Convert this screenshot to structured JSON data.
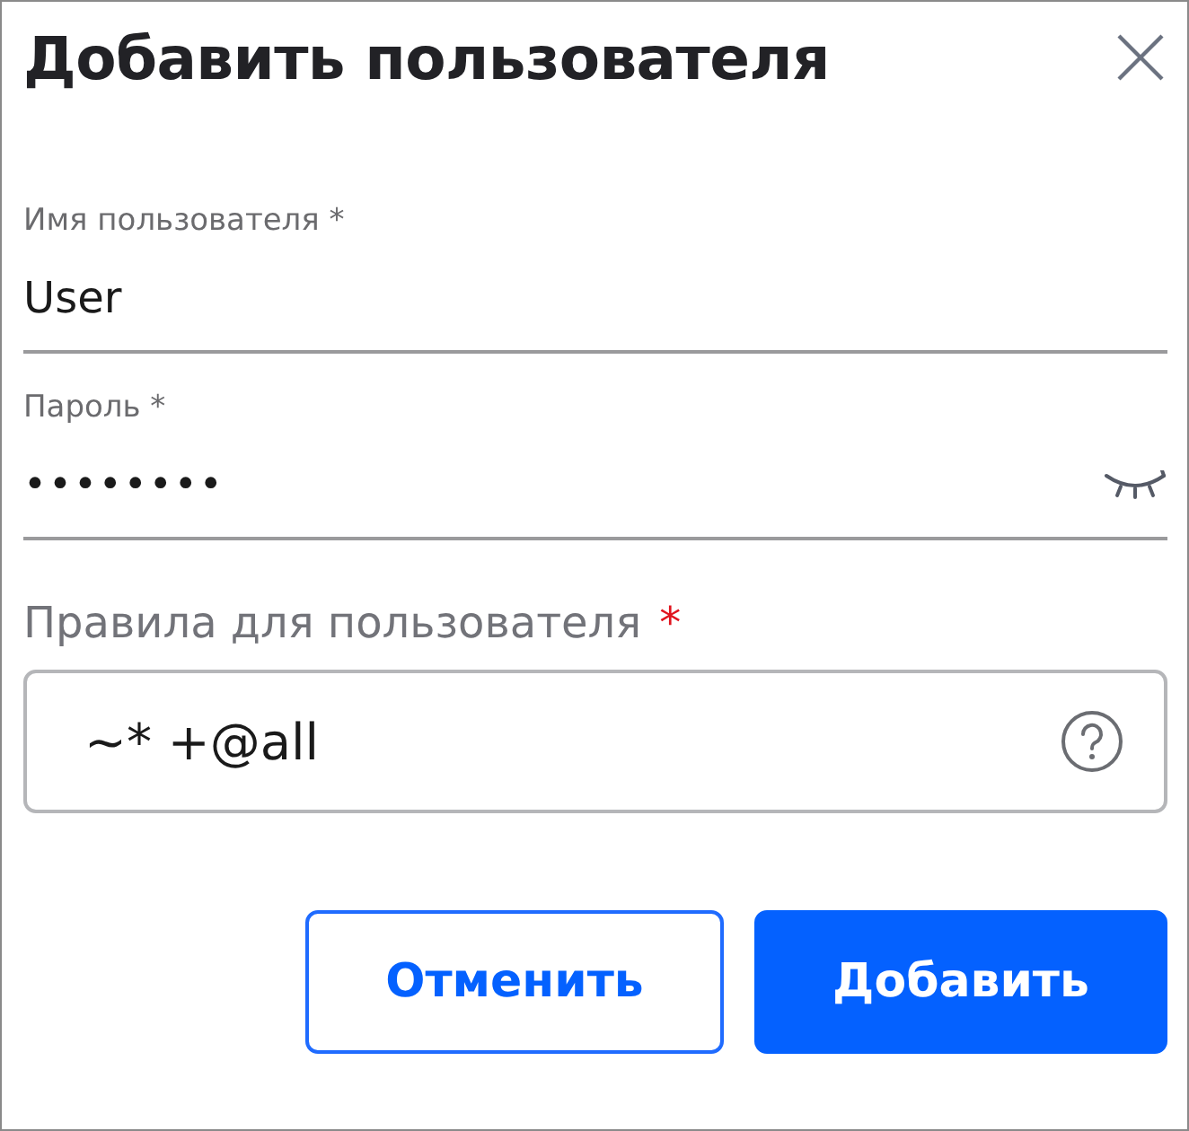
{
  "dialog": {
    "title": "Добавить пользователя"
  },
  "fields": [
    {
      "kind": "text",
      "label": "Имя пользователя *",
      "value": "User"
    },
    {
      "kind": "password",
      "label": "Пароль *",
      "value": "••••••••"
    }
  ],
  "rules": {
    "label": "Правила для пользователя",
    "required_mark": "*",
    "value": "~* +@all"
  },
  "buttons": [
    {
      "kind": "secondary",
      "label": "Отменить"
    },
    {
      "kind": "primary",
      "label": "Добавить"
    }
  ]
}
